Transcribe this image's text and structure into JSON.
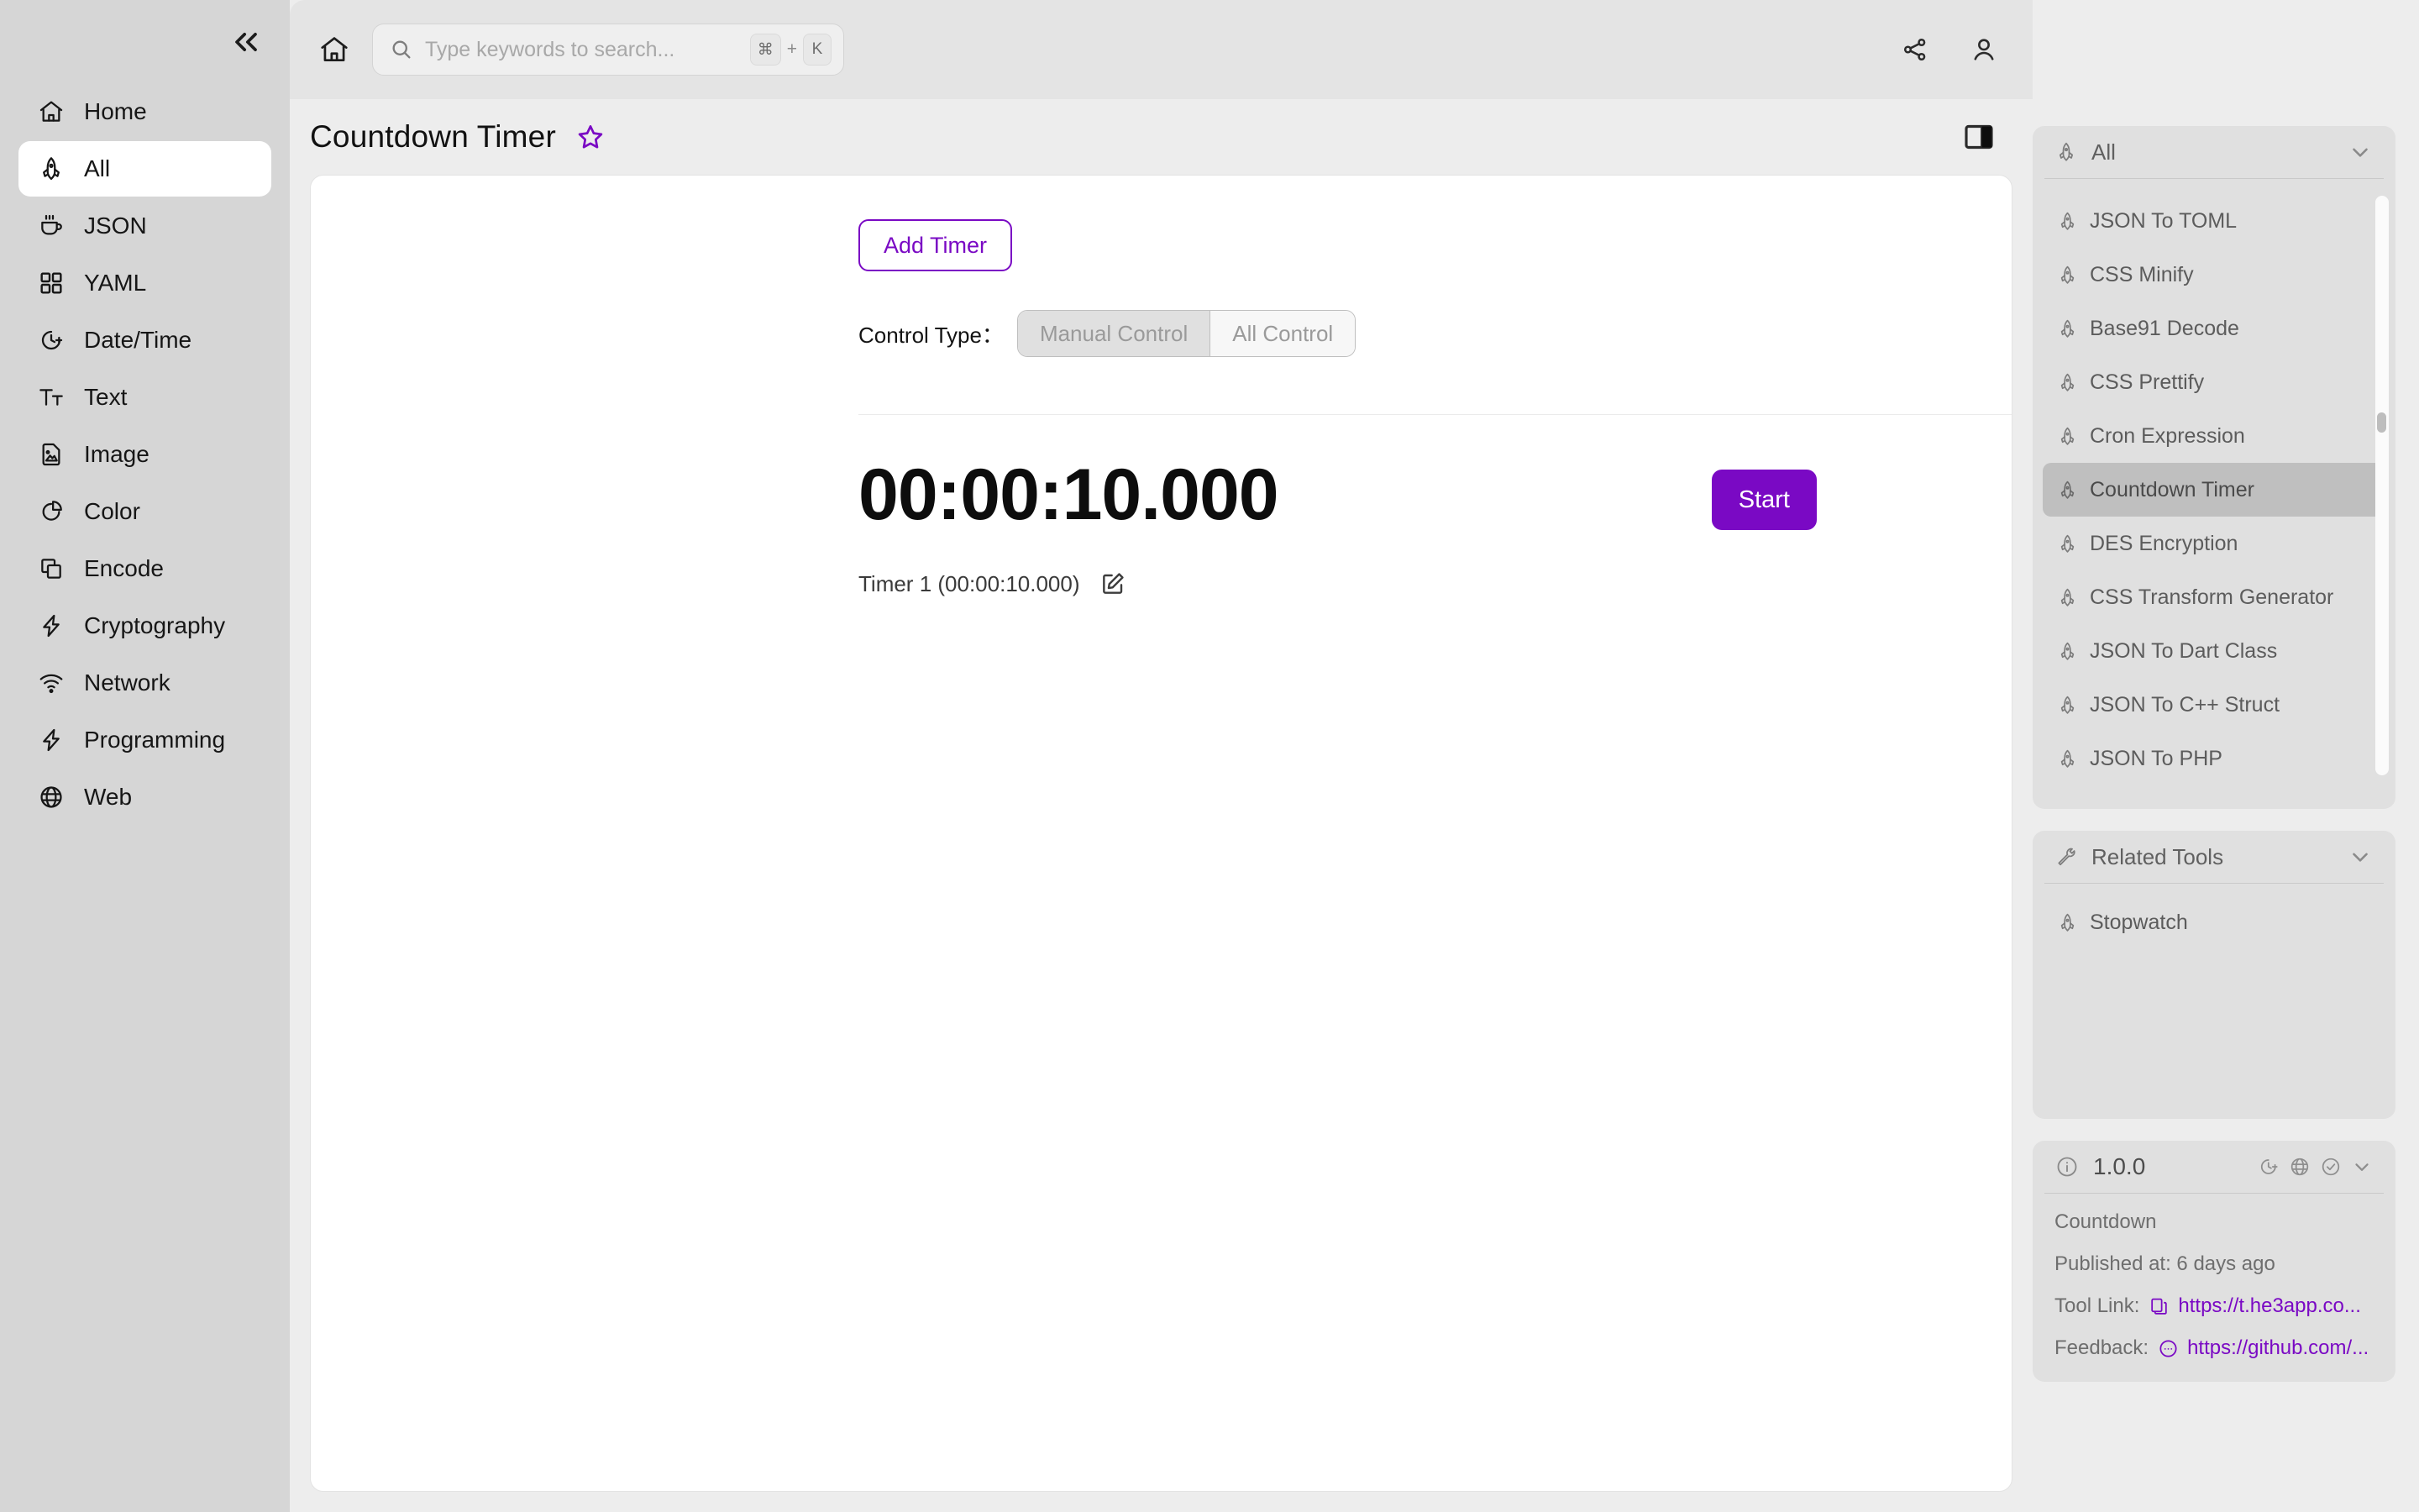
{
  "sidebar": {
    "collapse_icon": "chevrons-left-icon",
    "items": [
      {
        "label": "Home",
        "icon": "home-icon",
        "active": false
      },
      {
        "label": "All",
        "icon": "rocket-icon",
        "active": true
      },
      {
        "label": "JSON",
        "icon": "coffee-icon",
        "active": false
      },
      {
        "label": "YAML",
        "icon": "grid-icon",
        "active": false
      },
      {
        "label": "Date/Time",
        "icon": "clock-icon",
        "active": false
      },
      {
        "label": "Text",
        "icon": "text-icon",
        "active": false
      },
      {
        "label": "Image",
        "icon": "image-icon",
        "active": false
      },
      {
        "label": "Color",
        "icon": "pie-chart-icon",
        "active": false
      },
      {
        "label": "Encode",
        "icon": "copy-icon",
        "active": false
      },
      {
        "label": "Cryptography",
        "icon": "bolt-icon",
        "active": false
      },
      {
        "label": "Network",
        "icon": "wifi-icon",
        "active": false
      },
      {
        "label": "Programming",
        "icon": "bolt-icon",
        "active": false
      },
      {
        "label": "Web",
        "icon": "globe-icon",
        "active": false
      }
    ]
  },
  "topbar": {
    "home_icon": "home-icon",
    "search": {
      "icon": "search-icon",
      "placeholder": "Type keywords to search...",
      "value": "",
      "shortcut_key_1": "⌘",
      "shortcut_plus": "+",
      "shortcut_key_2": "K"
    },
    "share_icon": "share-icon",
    "account_icon": "user-icon"
  },
  "page": {
    "title": "Countdown Timer",
    "favorite_icon": "star-icon",
    "panel_toggle_icon": "right-panel-toggle-icon"
  },
  "main": {
    "add_timer_label": "Add Timer",
    "control_type_label": "Control Type：",
    "control_options": [
      {
        "label": "Manual Control",
        "selected": true
      },
      {
        "label": "All Control",
        "selected": false
      }
    ],
    "timer": {
      "display": "00:00:10.000",
      "label": "Timer 1 (00:00:10.000)",
      "edit_icon": "edit-icon",
      "start_label": "Start"
    }
  },
  "rightbar": {
    "all_panel": {
      "icon": "rocket-icon",
      "title": "All",
      "chevron_icon": "chevron-down-icon",
      "items": [
        {
          "label": "JSON To TOML",
          "active": false
        },
        {
          "label": "CSS Minify",
          "active": false
        },
        {
          "label": "Base91 Decode",
          "active": false
        },
        {
          "label": "CSS Prettify",
          "active": false
        },
        {
          "label": "Cron Expression",
          "active": false
        },
        {
          "label": "Countdown Timer",
          "active": true
        },
        {
          "label": "DES Encryption",
          "active": false
        },
        {
          "label": "CSS Transform Generator",
          "active": false
        },
        {
          "label": "JSON To Dart Class",
          "active": false
        },
        {
          "label": "JSON To C++ Struct",
          "active": false
        },
        {
          "label": "JSON To PHP",
          "active": false
        }
      ]
    },
    "related_panel": {
      "icon": "wrench-icon",
      "title": "Related Tools",
      "chevron_icon": "chevron-down-icon",
      "items": [
        {
          "label": "Stopwatch",
          "active": false
        }
      ]
    },
    "version_panel": {
      "info_icon": "info-circle-icon",
      "version": "1.0.0",
      "head_icons": [
        "history-icon",
        "globe-icon",
        "check-circle-icon",
        "chevron-down-icon"
      ],
      "name": "Countdown",
      "published": "Published at: 6 days ago",
      "tool_link_label": "Tool Link:",
      "tool_link_icon": "external-link-icon",
      "tool_link_url": "https://t.he3app.co...",
      "feedback_label": "Feedback:",
      "feedback_icon": "comment-icon",
      "feedback_url": "https://github.com/..."
    }
  },
  "colors": {
    "accent": "#7a09c4",
    "sidebar_bg": "#d6d6d6",
    "panel_bg": "#e0e0e0",
    "page_bg": "#ededed"
  }
}
